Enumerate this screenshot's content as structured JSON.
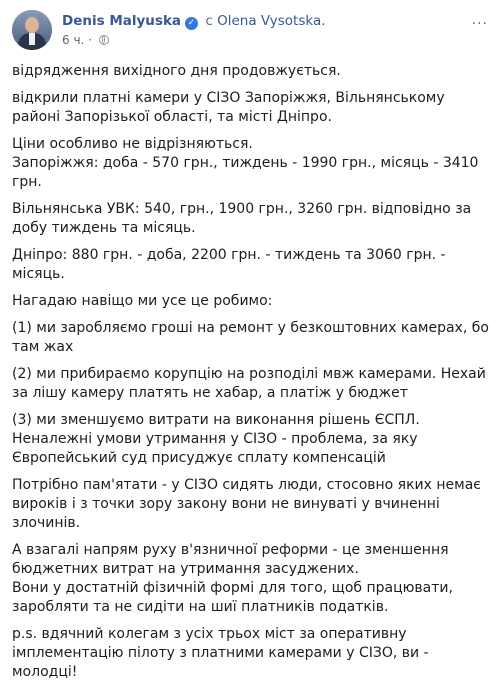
{
  "post": {
    "author": "Denis Malyuska",
    "verified_glyph": "✓",
    "with_label": "с",
    "tagged_user": "Olena Vysotska.",
    "time": "6 ч.",
    "time_separator": "·",
    "privacy_icon": "globe-icon",
    "more_icon": "more-options-icon",
    "more_glyph": "···",
    "accent_color": "#385898",
    "paragraphs": [
      "відрядження вихідного дня продовжується.",
      "відкрили платні камери у СІЗО Запоріжжя, Вільнянському районі Запорізької області, та місті Дніпро.",
      "Ціни особливо не відрізняються.\nЗапоріжжя: доба - 570 грн., тиждень - 1990 грн., місяць - 3410 грн.",
      "Вільнянська УВК: 540, грн., 1900 грн., 3260 грн. відповідно за добу тиждень та місяць.",
      "Дніпро: 880 грн. - доба, 2200 грн. - тиждень та 3060 грн. - місяць.",
      "Нагадаю навіщо ми усе це робимо:",
      "(1) ми заробляємо гроші на ремонт у безкоштовних камерах, бо там жах",
      "(2) ми прибираємо корупцію на розподілі мвж камерами. Нехай за лішу камеру платять не хабар, а платіж у бюджет",
      "(3) ми зменшуємо витрати на виконання рішень ЄСПЛ. Неналежні умови утримання у СІЗО - проблема, за яку Європейський суд присуджує сплату компенсацій",
      "Потрібно пам'ятати - у СІЗО сидять люди, стосовно яких немає вироків і з точки зору закону вони не винуваті у вчиненні злочинів.",
      "А взагалі напрям руху в'язничної реформи - це зменшення бюджетних витрат на утримання засуджених.\nВони у достатній фізичній формі для того, щоб працювати, заробляти та не сидіти на шиї платників податків.",
      "p.s. вдячний колегам з усіх трьох міст за оперативну імплементацію пілоту з платними камерами у СІЗО, ви - молодці!"
    ]
  }
}
